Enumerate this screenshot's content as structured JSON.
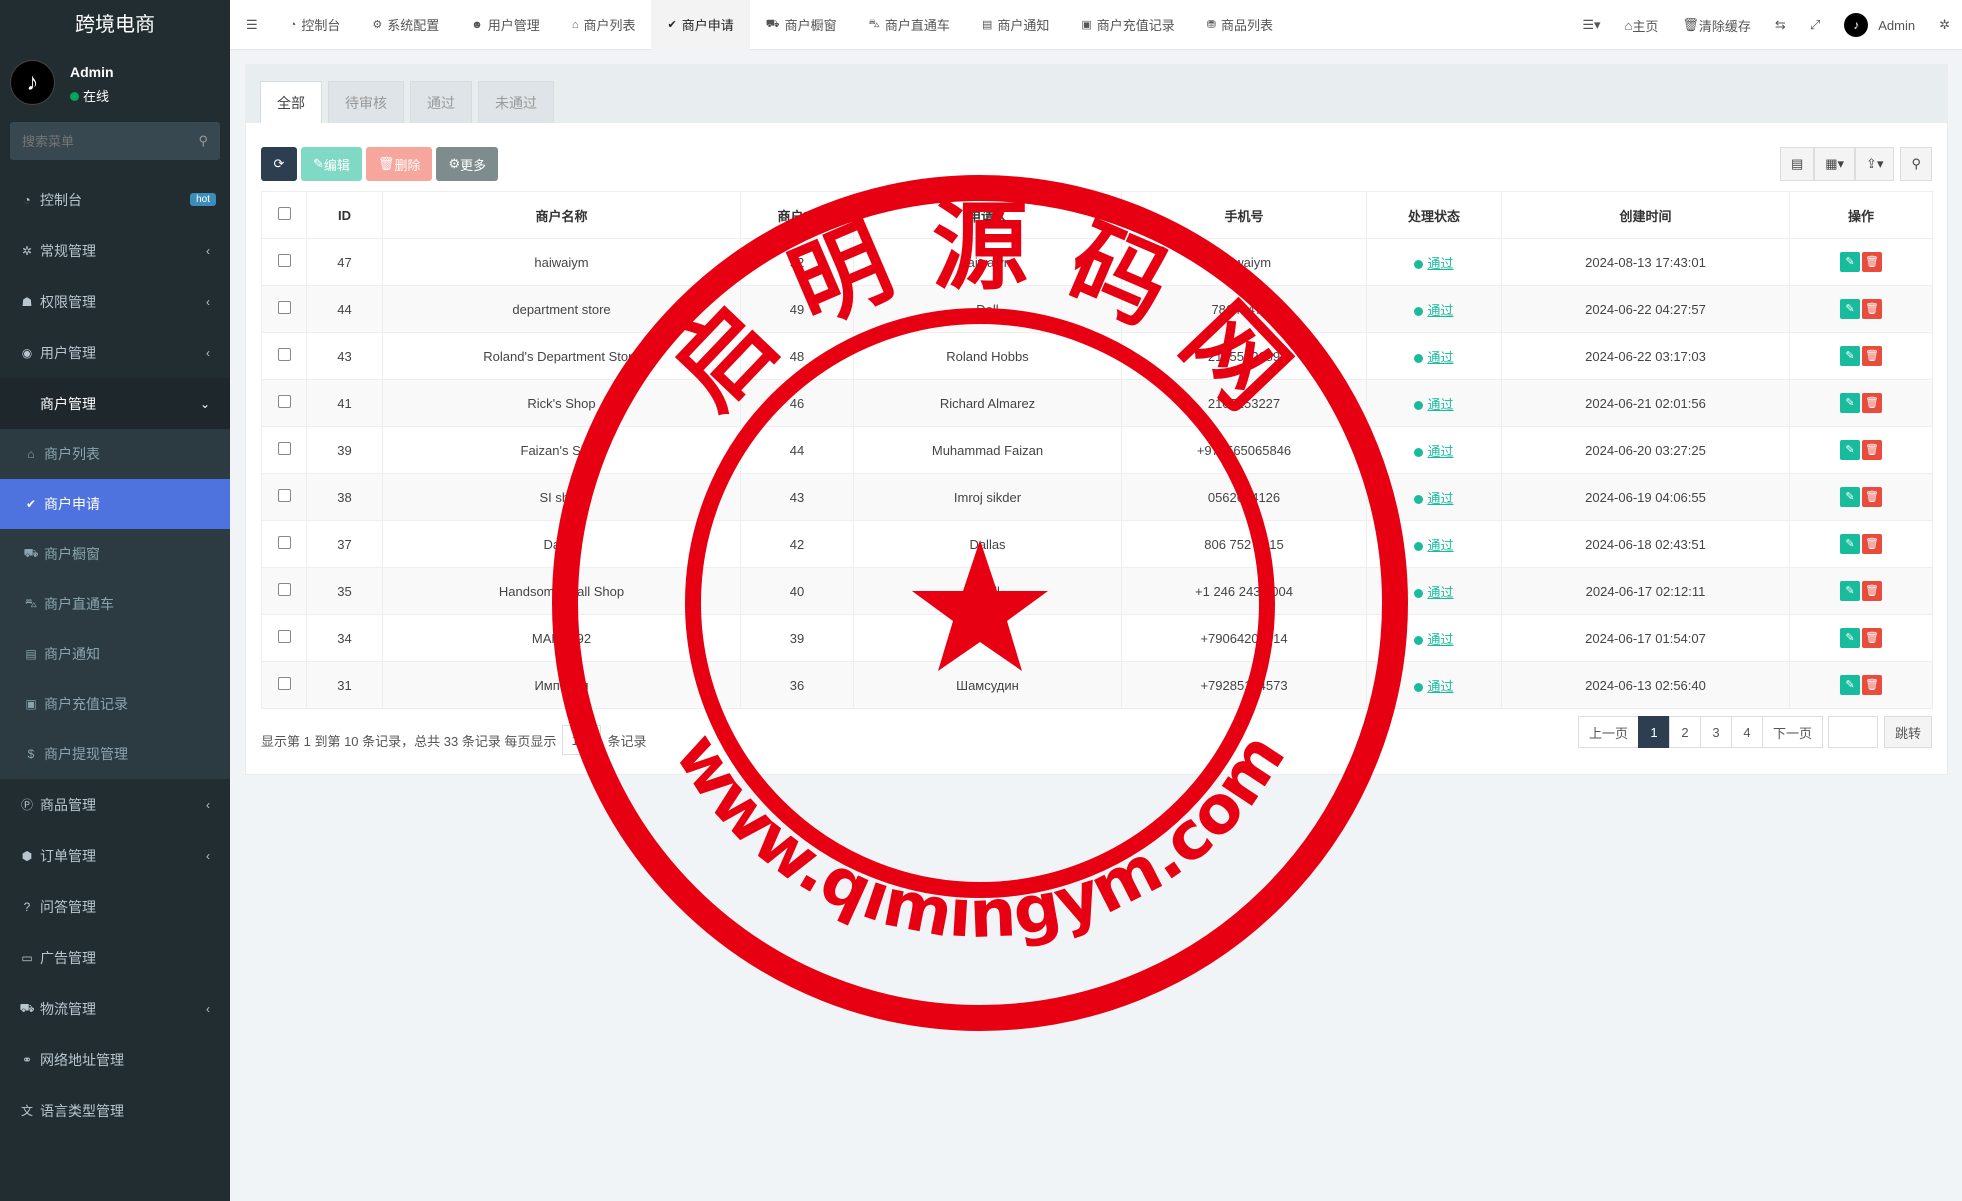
{
  "sidebar": {
    "app_title": "跨境电商",
    "user": {
      "name": "Admin",
      "status": "在线"
    },
    "search_placeholder": "搜索菜单",
    "menu": [
      {
        "label": "控制台",
        "icon": "dashboard-icon",
        "badge": "hot"
      },
      {
        "label": "常规管理",
        "icon": "cogs-icon"
      },
      {
        "label": "权限管理",
        "icon": "group-icon"
      },
      {
        "label": "用户管理",
        "icon": "user-circle-icon"
      },
      {
        "label": "商户管理",
        "icon": "apple-icon"
      }
    ],
    "submenu": [
      {
        "label": "商户列表",
        "icon": "home-icon"
      },
      {
        "label": "商户申请",
        "icon": "check-circle-icon"
      },
      {
        "label": "商户橱窗",
        "icon": "cart-icon"
      },
      {
        "label": "商户直通车",
        "icon": "car-icon"
      },
      {
        "label": "商户通知",
        "icon": "list-alt-icon"
      },
      {
        "label": "商户充值记录",
        "icon": "money-icon"
      },
      {
        "label": "商户提现管理",
        "icon": "dollar-icon"
      }
    ],
    "menu_bottom": [
      {
        "label": "商品管理",
        "icon": "product-hunt-icon"
      },
      {
        "label": "订单管理",
        "icon": "cube-icon"
      },
      {
        "label": "问答管理",
        "icon": "question-circle-icon"
      },
      {
        "label": "广告管理",
        "icon": "credit-card-icon"
      },
      {
        "label": "物流管理",
        "icon": "truck-icon"
      },
      {
        "label": "网络地址管理",
        "icon": "link-icon"
      },
      {
        "label": "语言类型管理",
        "icon": "language-icon"
      }
    ]
  },
  "topnav": {
    "tabs": [
      {
        "label": "控制台",
        "icon": "dashboard-icon"
      },
      {
        "label": "系统配置",
        "icon": "gear-icon"
      },
      {
        "label": "用户管理",
        "icon": "user-icon"
      },
      {
        "label": "商户列表",
        "icon": "home-icon"
      },
      {
        "label": "商户申请",
        "icon": "check-circle-icon"
      },
      {
        "label": "商户橱窗",
        "icon": "cart-icon"
      },
      {
        "label": "商户直通车",
        "icon": "car-icon"
      },
      {
        "label": "商户通知",
        "icon": "list-alt-icon"
      },
      {
        "label": "商户充值记录",
        "icon": "money-icon"
      },
      {
        "label": "商品列表",
        "icon": "shopping-bag-icon"
      }
    ],
    "home": "主页",
    "clear_cache": "清除缓存",
    "user": "Admin"
  },
  "main": {
    "filter_tabs": [
      "全部",
      "待审核",
      "通过",
      "未通过"
    ],
    "toolbar": {
      "edit": "编辑",
      "delete": "删除",
      "more": "更多"
    },
    "columns": [
      "ID",
      "商户名称",
      "商户ID",
      "申请人",
      "手机号",
      "处理状态",
      "创建时间",
      "操作"
    ],
    "rows": [
      {
        "id": "47",
        "name": "haiwaiym",
        "mid": "52",
        "applicant": "haiwaiym",
        "phone": "haiwaiym",
        "status": "通过",
        "created": "2024-08-13 17:43:01"
      },
      {
        "id": "44",
        "name": "department store",
        "mid": "49",
        "applicant": "Dell",
        "phone": "786424763",
        "status": "通过",
        "created": "2024-06-22 04:27:57"
      },
      {
        "id": "43",
        "name": "Roland's Department Store",
        "mid": "48",
        "applicant": "Roland Hobbs",
        "phone": "2135552689",
        "status": "通过",
        "created": "2024-06-22 03:17:03"
      },
      {
        "id": "41",
        "name": "Rick's Shop",
        "mid": "46",
        "applicant": "Richard Almarez",
        "phone": "2107253227",
        "status": "通过",
        "created": "2024-06-21 02:01:56"
      },
      {
        "id": "39",
        "name": "Faizan's Shop",
        "mid": "44",
        "applicant": "Muhammad Faizan",
        "phone": "+971565065846",
        "status": "通过",
        "created": "2024-06-20 03:27:25"
      },
      {
        "id": "38",
        "name": "SI shop",
        "mid": "43",
        "applicant": "Imroj sikder",
        "phone": "0562674126",
        "status": "通过",
        "created": "2024-06-19 04:06:55"
      },
      {
        "id": "37",
        "name": "Dallas",
        "mid": "42",
        "applicant": "Dallas",
        "phone": "806 752 0215",
        "status": "通过",
        "created": "2024-06-18 02:43:51"
      },
      {
        "id": "35",
        "name": "Handsome Wall Shop",
        "mid": "40",
        "applicant": "Wall",
        "phone": "+1 246 243 4004",
        "status": "通过",
        "created": "2024-06-17 02:12:11"
      },
      {
        "id": "34",
        "name": "MARK092",
        "mid": "39",
        "applicant": "Mark",
        "phone": "+79064202814",
        "status": "通过",
        "created": "2024-06-17 01:54:07"
      },
      {
        "id": "31",
        "name": "Империя",
        "mid": "36",
        "applicant": "Шамсудин",
        "phone": "+79285154573",
        "status": "通过",
        "created": "2024-06-13 02:56:40"
      }
    ],
    "footer": {
      "prefix": "显示第 1 到第 10 条记录，总共 33 条记录 每页显示",
      "page_size": "10",
      "suffix": "条记录"
    },
    "pager": {
      "prev": "上一页",
      "pages": [
        "1",
        "2",
        "3",
        "4"
      ],
      "next": "下一页",
      "jump": "跳转"
    }
  },
  "stamp": {
    "top_text": "启 明 源 码 网",
    "bottom_text": "www.qimingym.com",
    "color": "#e60012"
  }
}
